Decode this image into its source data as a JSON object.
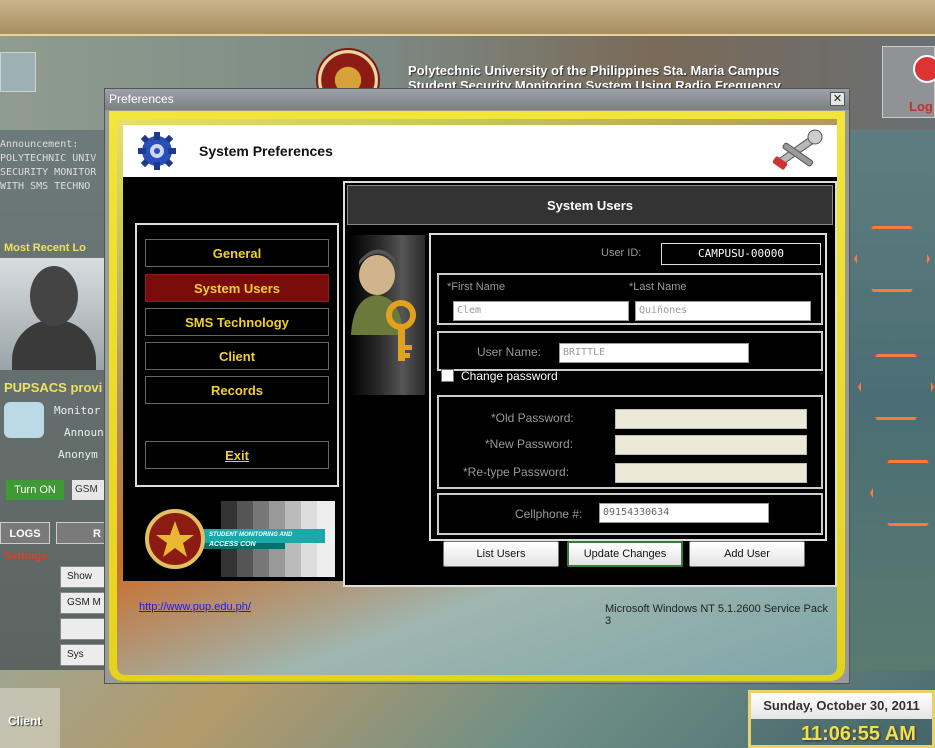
{
  "background": {
    "university_title": "Polytechnic University of the Philippines Sta. Maria Campus",
    "system_title": "Student Security Monitoring System Using Radio Frequency",
    "logout_label": "Log",
    "announcement_lines": [
      "Announcement:",
      "",
      "POLYTECHNIC UNIV",
      "SECURITY MONITOR",
      "WITH SMS TECHNO"
    ],
    "most_recent_label": "Most Recent Lo",
    "provider_label": "PUPSACS provi",
    "provider_rows": [
      "Monitor",
      "Announ",
      "Anonym"
    ],
    "turn_on_label": "Turn ON",
    "gsm_label": "GSM",
    "logs_label": "LOGS",
    "r_label": "R",
    "settings_label": "Settings",
    "side_buttons": [
      "Show",
      "GSM M",
      "",
      "Sys"
    ],
    "client_label": "Client",
    "date": "Sunday, October 30, 2011",
    "time": "11:06:55 AM"
  },
  "dialog": {
    "window_title": "Preferences",
    "close_glyph": "✕",
    "header_title": "System Preferences",
    "nav": {
      "items": [
        {
          "label": "General"
        },
        {
          "label": "System Users"
        },
        {
          "label": "SMS Technology"
        },
        {
          "label": "Client"
        },
        {
          "label": "Records"
        }
      ],
      "exit_label": "Exit"
    },
    "logo_text": [
      "STUDENT MONITORING AND",
      "ACCESS CON"
    ],
    "panel": {
      "title": "System Users",
      "user_id_label": "User ID:",
      "user_id_value": "CAMPUSU-00000",
      "first_name_label": "*First Name",
      "last_name_label": "*Last Name",
      "first_name_value": "Clem",
      "last_name_value": "Quiñones",
      "user_name_label": "User Name:",
      "user_name_value": "BRITTLE",
      "change_password_label": "Change password",
      "old_password_label": "*Old Password:",
      "new_password_label": "*New Password:",
      "retype_password_label": "*Re-type Password:",
      "cellphone_label": "Cellphone #:",
      "cellphone_value": "09154330634"
    },
    "buttons": {
      "list_users": "List Users",
      "update_changes": "Update Changes",
      "add_user": "Add User"
    },
    "url": "http://www.pup.edu.ph/",
    "os_info": "Microsoft Windows NT 5.1.2600 Service Pack 3"
  }
}
